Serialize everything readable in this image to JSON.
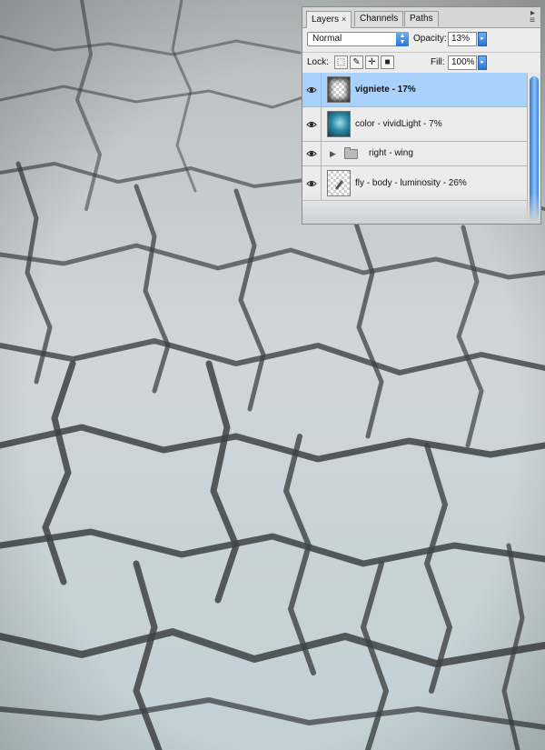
{
  "panel": {
    "tabs": [
      {
        "label": "Layers",
        "active": true,
        "close": "×"
      },
      {
        "label": "Channels",
        "active": false
      },
      {
        "label": "Paths",
        "active": false
      }
    ],
    "menu_icon": "panel-menu-icon",
    "blend_mode": "Normal",
    "opacity_label": "Opacity:",
    "opacity_value": "13%",
    "lock_label": "Lock:",
    "fill_label": "Fill:",
    "fill_value": "100%",
    "lock_icons": [
      "lock-transparency-icon",
      "lock-pixels-icon",
      "lock-position-icon",
      "lock-all-icon"
    ],
    "layers": [
      {
        "name": "vigniete - 17%",
        "selected": true,
        "type": "layer"
      },
      {
        "name": "color - vividLight - 7%",
        "selected": false,
        "type": "layer"
      },
      {
        "name": "right - wing",
        "selected": false,
        "type": "group"
      },
      {
        "name": "fly - body - luminosity - 26%",
        "selected": false,
        "type": "layer"
      }
    ]
  },
  "colors": {
    "selected_row": "#a8d2fb",
    "accent": "#2b74d8",
    "canvas": "#c9ced1"
  }
}
